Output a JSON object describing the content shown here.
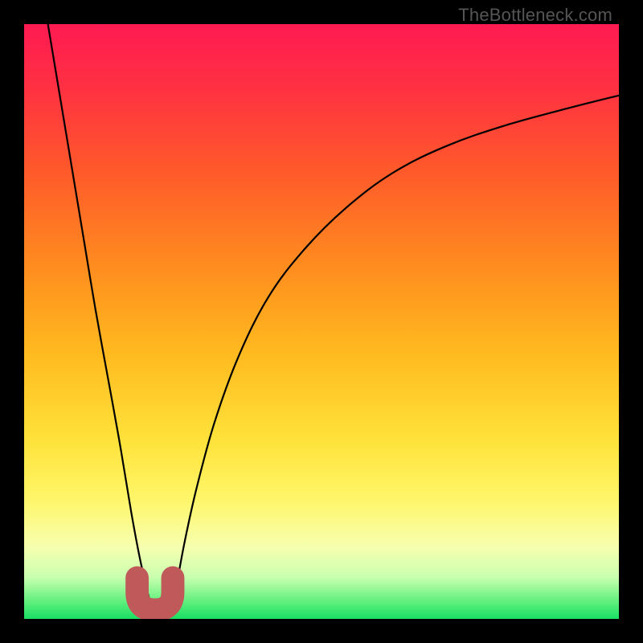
{
  "watermark": "TheBottleneck.com",
  "colors": {
    "frame": "#000000",
    "curve": "#000000",
    "marker_fill": "#c05a5a",
    "marker_stroke": "#c05a5a",
    "gradient_stops": [
      {
        "offset": 0.0,
        "color": "#ff1a52"
      },
      {
        "offset": 0.1,
        "color": "#ff2f43"
      },
      {
        "offset": 0.25,
        "color": "#ff5a2a"
      },
      {
        "offset": 0.4,
        "color": "#ff8a1f"
      },
      {
        "offset": 0.55,
        "color": "#ffb91f"
      },
      {
        "offset": 0.7,
        "color": "#ffe23a"
      },
      {
        "offset": 0.8,
        "color": "#fff66a"
      },
      {
        "offset": 0.88,
        "color": "#f6ffb0"
      },
      {
        "offset": 0.93,
        "color": "#c9ffaf"
      },
      {
        "offset": 0.97,
        "color": "#63f07e"
      },
      {
        "offset": 1.0,
        "color": "#18df62"
      }
    ]
  },
  "chart_data": {
    "type": "line",
    "title": "",
    "xlabel": "",
    "ylabel": "",
    "xlim": [
      0,
      100
    ],
    "ylim": [
      0,
      100
    ],
    "grid": false,
    "legend": false,
    "series": [
      {
        "name": "left-branch",
        "x": [
          4,
          6,
          8,
          10,
          12,
          14,
          16,
          18,
          19.5,
          21,
          21.8
        ],
        "y": [
          100,
          88,
          76,
          64,
          52,
          41,
          30,
          18,
          10,
          3.5,
          0.5
        ]
      },
      {
        "name": "right-branch",
        "x": [
          24.5,
          25.5,
          27,
          29,
          32,
          36,
          41,
          47,
          54,
          62,
          71,
          81,
          92,
          100
        ],
        "y": [
          0.5,
          5,
          13,
          22,
          33,
          44,
          54,
          62,
          69,
          75,
          79.5,
          83,
          86,
          88
        ]
      }
    ],
    "markers": [
      {
        "name": "u-marker",
        "shape": "U",
        "x": 22.0,
        "y": 1.5,
        "size": 3.0
      },
      {
        "name": "dot-marker",
        "shape": "dot",
        "x": 25.2,
        "y": 3.0,
        "r": 1.0
      }
    ],
    "annotations": []
  }
}
